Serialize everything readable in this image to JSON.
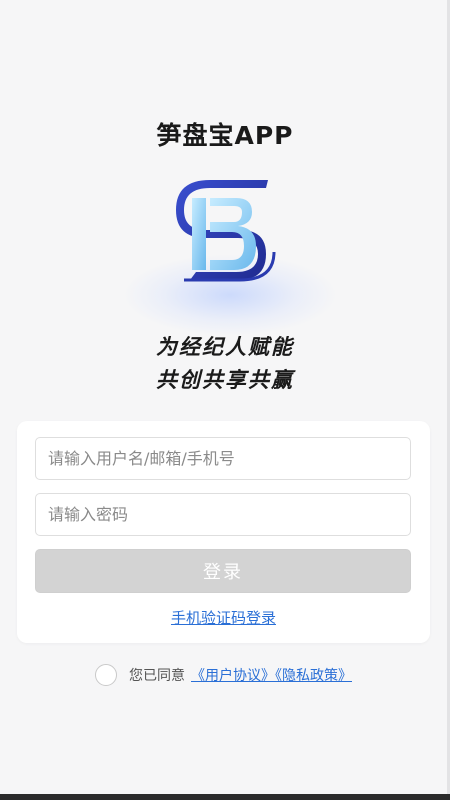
{
  "app": {
    "title": "笋盘宝APP",
    "logo_name": "sunpanbao-logo"
  },
  "slogan": {
    "line1": "为经纪人赋能",
    "line2": "共创共享共赢"
  },
  "login_form": {
    "username_placeholder": "请输入用户名/邮箱/手机号",
    "password_placeholder": "请输入密码",
    "login_button_label": "登录",
    "sms_login_link": "手机验证码登录"
  },
  "agreement": {
    "prefix_text": "您已同意",
    "links_text": "《用户协议》《隐私政策》",
    "checked": false
  },
  "colors": {
    "background": "#f6f6f7",
    "card": "#ffffff",
    "button_disabled": "#d3d3d3",
    "link": "#2a6fd6",
    "logo_dark_blue": "#2a3bb0",
    "logo_light_blue": "#8fd0f5"
  }
}
